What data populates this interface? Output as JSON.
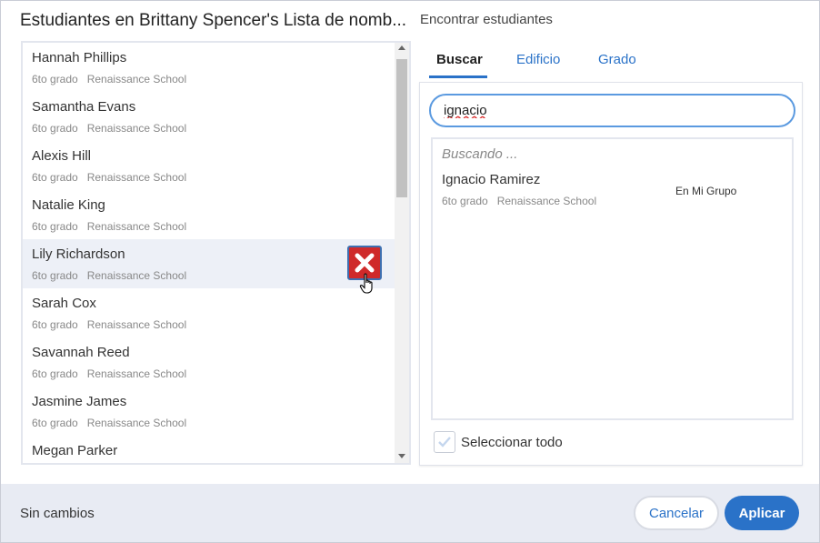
{
  "dialog": {
    "title": "Estudiantes en Brittany Spencer's Lista de nomb...",
    "find_title": "Encontrar estudiantes"
  },
  "roster": {
    "students": [
      {
        "name": "Hannah Phillips",
        "grade": "6to grado",
        "school": "Renaissance School"
      },
      {
        "name": "Samantha Evans",
        "grade": "6to grado",
        "school": "Renaissance School"
      },
      {
        "name": "Alexis Hill",
        "grade": "6to grado",
        "school": "Renaissance School"
      },
      {
        "name": "Natalie King",
        "grade": "6to grado",
        "school": "Renaissance School"
      },
      {
        "name": "Lily Richardson",
        "grade": "6to grado",
        "school": "Renaissance School"
      },
      {
        "name": "Sarah Cox",
        "grade": "6to grado",
        "school": "Renaissance School"
      },
      {
        "name": "Savannah Reed",
        "grade": "6to grado",
        "school": "Renaissance School"
      },
      {
        "name": "Jasmine James",
        "grade": "6to grado",
        "school": "Renaissance School"
      },
      {
        "name": "Megan Parker",
        "grade": "",
        "school": ""
      }
    ],
    "hovered_index": 4
  },
  "tabs": {
    "search": "Buscar",
    "building": "Edificio",
    "grade": "Grado"
  },
  "search": {
    "value": "ignacio",
    "status": "Buscando ...",
    "results": [
      {
        "name": "Ignacio Ramirez",
        "grade": "6to grado",
        "school": "Renaissance School",
        "badge": "En Mi Grupo"
      }
    ],
    "select_all_label": "Seleccionar todo"
  },
  "footer": {
    "status": "Sin cambios",
    "cancel_label": "Cancelar",
    "apply_label": "Aplicar"
  },
  "colors": {
    "accent": "#2a72c8",
    "remove": "#cf2a2a",
    "footer_bg": "#e8ebf3"
  }
}
